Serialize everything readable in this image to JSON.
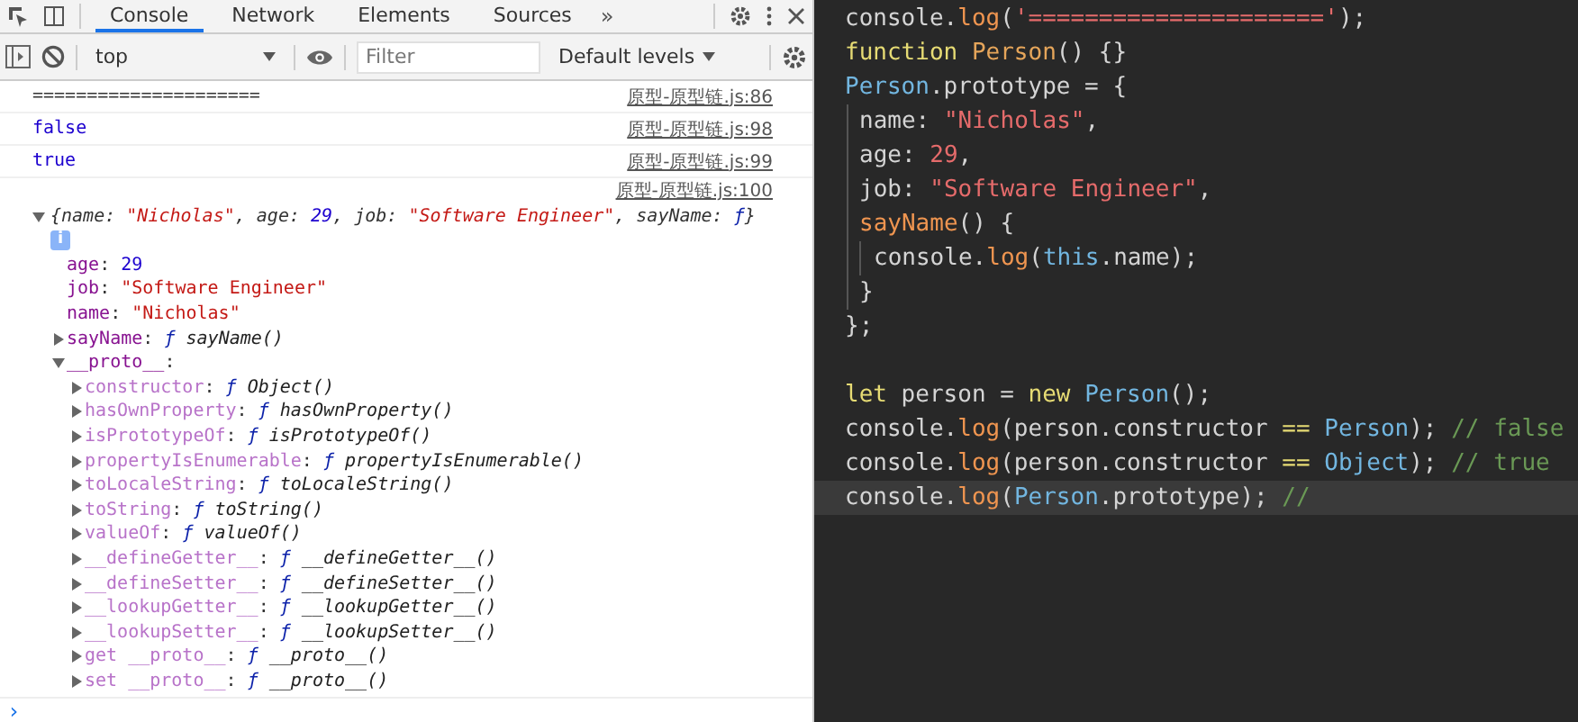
{
  "devtools": {
    "tabs": [
      {
        "label": "Console",
        "selected": true
      },
      {
        "label": "Network",
        "selected": false
      },
      {
        "label": "Elements",
        "selected": false
      },
      {
        "label": "Sources",
        "selected": false
      }
    ],
    "more_tabs": "»",
    "toolbar": {
      "context": "top",
      "filter_placeholder": "Filter",
      "levels": "Default levels"
    },
    "messages": [
      {
        "kind": "plain",
        "text": "=====================",
        "source": "原型-原型链.js:86"
      },
      {
        "kind": "boolean",
        "text": "false",
        "source": "原型-原型链.js:98"
      },
      {
        "kind": "boolean",
        "text": "true",
        "source": "原型-原型链.js:99"
      }
    ],
    "object_entry": {
      "source": "原型-原型链.js:100",
      "expanded": true,
      "summary": [
        {
          "t": "{name: ",
          "kind": "punct"
        },
        {
          "t": "\"Nicholas\"",
          "kind": "string"
        },
        {
          "t": ", age: ",
          "kind": "punct"
        },
        {
          "t": "29",
          "kind": "number"
        },
        {
          "t": ", job: ",
          "kind": "punct"
        },
        {
          "t": "\"Software Engineer\"",
          "kind": "string"
        },
        {
          "t": ", sayName: ",
          "kind": "punct"
        },
        {
          "t": "ƒ",
          "kind": "fn"
        },
        {
          "t": "}",
          "kind": "punct"
        }
      ],
      "info": "i",
      "properties": [
        {
          "key": "age",
          "sep": ": ",
          "kind": "number",
          "value": "29",
          "dim": false
        },
        {
          "key": "job",
          "sep": ": ",
          "kind": "string",
          "value": "\"Software Engineer\"",
          "dim": false
        },
        {
          "key": "name",
          "sep": ": ",
          "kind": "string",
          "value": "\"Nicholas\"",
          "dim": false
        },
        {
          "key": "sayName",
          "sep": ": ",
          "kind": "function",
          "fn": "ƒ",
          "value": "sayName()",
          "dim": false,
          "expanded": false
        },
        {
          "key": "__proto__",
          "sep": ":",
          "kind": "object",
          "dim": false,
          "expanded": true,
          "children": [
            {
              "key": "constructor",
              "sep": ": ",
              "kind": "function",
              "fn": "ƒ",
              "value": "Object()",
              "dim": true,
              "expanded": false
            },
            {
              "key": "hasOwnProperty",
              "sep": ": ",
              "kind": "function",
              "fn": "ƒ",
              "value": "hasOwnProperty()",
              "dim": true,
              "expanded": false
            },
            {
              "key": "isPrototypeOf",
              "sep": ": ",
              "kind": "function",
              "fn": "ƒ",
              "value": "isPrototypeOf()",
              "dim": true,
              "expanded": false
            },
            {
              "key": "propertyIsEnumerable",
              "sep": ": ",
              "kind": "function",
              "fn": "ƒ",
              "value": "propertyIsEnumerable()",
              "dim": true,
              "expanded": false
            },
            {
              "key": "toLocaleString",
              "sep": ": ",
              "kind": "function",
              "fn": "ƒ",
              "value": "toLocaleString()",
              "dim": true,
              "expanded": false
            },
            {
              "key": "toString",
              "sep": ": ",
              "kind": "function",
              "fn": "ƒ",
              "value": "toString()",
              "dim": true,
              "expanded": false
            },
            {
              "key": "valueOf",
              "sep": ": ",
              "kind": "function",
              "fn": "ƒ",
              "value": "valueOf()",
              "dim": true,
              "expanded": false
            },
            {
              "key": "__defineGetter__",
              "sep": ": ",
              "kind": "function",
              "fn": "ƒ",
              "value": "__defineGetter__()",
              "dim": true,
              "expanded": false
            },
            {
              "key": "__defineSetter__",
              "sep": ": ",
              "kind": "function",
              "fn": "ƒ",
              "value": "__defineSetter__()",
              "dim": true,
              "expanded": false
            },
            {
              "key": "__lookupGetter__",
              "sep": ": ",
              "kind": "function",
              "fn": "ƒ",
              "value": "__lookupGetter__()",
              "dim": true,
              "expanded": false
            },
            {
              "key": "__lookupSetter__",
              "sep": ": ",
              "kind": "function",
              "fn": "ƒ",
              "value": "__lookupSetter__()",
              "dim": true,
              "expanded": false
            },
            {
              "key": "get __proto__",
              "sep": ": ",
              "kind": "function",
              "fn": "ƒ",
              "value": "__proto__()",
              "dim": true,
              "expanded": false
            },
            {
              "key": "set __proto__",
              "sep": ": ",
              "kind": "function",
              "fn": "ƒ",
              "value": "__proto__()",
              "dim": true,
              "expanded": false
            }
          ]
        }
      ]
    },
    "prompt": "›"
  },
  "editor": {
    "lines": [
      {
        "kind": "code",
        "current": false,
        "tokens": [
          {
            "t": "console.",
            "kind": "plain"
          },
          {
            "t": "log",
            "kind": "method"
          },
          {
            "t": "(",
            "kind": "plain"
          },
          {
            "t": "'====================='",
            "kind": "string"
          },
          {
            "t": ");",
            "kind": "plain"
          }
        ]
      },
      {
        "kind": "code",
        "current": false,
        "tokens": [
          {
            "t": "function ",
            "kind": "keyword"
          },
          {
            "t": "Person",
            "kind": "class"
          },
          {
            "t": "() {}",
            "kind": "plain"
          }
        ]
      },
      {
        "kind": "code",
        "current": false,
        "tokens": [
          {
            "t": "Person",
            "kind": "ident"
          },
          {
            "t": ".prototype = {",
            "kind": "plain"
          }
        ],
        "children": [
          {
            "kind": "code",
            "current": false,
            "tokens": [
              {
                "t": "name: ",
                "kind": "plain"
              },
              {
                "t": "\"Nicholas\"",
                "kind": "string"
              },
              {
                "t": ",",
                "kind": "plain"
              }
            ]
          },
          {
            "kind": "code",
            "current": false,
            "tokens": [
              {
                "t": "age: ",
                "kind": "plain"
              },
              {
                "t": "29",
                "kind": "number"
              },
              {
                "t": ",",
                "kind": "plain"
              }
            ]
          },
          {
            "kind": "code",
            "current": false,
            "tokens": [
              {
                "t": "job: ",
                "kind": "plain"
              },
              {
                "t": "\"Software Engineer\"",
                "kind": "string"
              },
              {
                "t": ",",
                "kind": "plain"
              }
            ]
          },
          {
            "kind": "code",
            "current": false,
            "tokens": [
              {
                "t": "sayName",
                "kind": "method"
              },
              {
                "t": "() {",
                "kind": "plain"
              }
            ],
            "children": [
              {
                "kind": "code",
                "current": false,
                "tokens": [
                  {
                    "t": "console.",
                    "kind": "plain"
                  },
                  {
                    "t": "log",
                    "kind": "method"
                  },
                  {
                    "t": "(",
                    "kind": "plain"
                  },
                  {
                    "t": "this",
                    "kind": "ident"
                  },
                  {
                    "t": ".name);",
                    "kind": "plain"
                  }
                ]
              }
            ]
          },
          {
            "kind": "code",
            "current": false,
            "tokens": [
              {
                "t": "}",
                "kind": "plain"
              }
            ]
          }
        ]
      },
      {
        "kind": "code",
        "current": false,
        "tokens": [
          {
            "t": "};",
            "kind": "plain"
          }
        ]
      },
      {
        "kind": "blank"
      },
      {
        "kind": "code",
        "current": false,
        "tokens": [
          {
            "t": "let",
            "kind": "keyword"
          },
          {
            "t": " person = ",
            "kind": "plain"
          },
          {
            "t": "new ",
            "kind": "keyword"
          },
          {
            "t": "Person",
            "kind": "ident"
          },
          {
            "t": "();",
            "kind": "plain"
          }
        ]
      },
      {
        "kind": "code",
        "current": false,
        "tokens": [
          {
            "t": "console.",
            "kind": "plain"
          },
          {
            "t": "log",
            "kind": "method"
          },
          {
            "t": "(person.constructor ",
            "kind": "plain"
          },
          {
            "t": "== ",
            "kind": "keyword"
          },
          {
            "t": "Person",
            "kind": "ident"
          },
          {
            "t": "); ",
            "kind": "plain"
          },
          {
            "t": "// false",
            "kind": "comment"
          }
        ]
      },
      {
        "kind": "code",
        "current": false,
        "tokens": [
          {
            "t": "console.",
            "kind": "plain"
          },
          {
            "t": "log",
            "kind": "method"
          },
          {
            "t": "(person.constructor ",
            "kind": "plain"
          },
          {
            "t": "== ",
            "kind": "keyword"
          },
          {
            "t": "Object",
            "kind": "ident"
          },
          {
            "t": "); ",
            "kind": "plain"
          },
          {
            "t": "// true",
            "kind": "comment"
          }
        ]
      },
      {
        "kind": "code",
        "current": true,
        "tokens": [
          {
            "t": "console.",
            "kind": "plain"
          },
          {
            "t": "log",
            "kind": "method"
          },
          {
            "t": "(",
            "kind": "plain"
          },
          {
            "t": "Person",
            "kind": "ident"
          },
          {
            "t": ".prototype",
            "kind": "plain"
          },
          {
            "t": "); ",
            "kind": "plain"
          },
          {
            "t": "//",
            "kind": "comment"
          }
        ]
      }
    ]
  }
}
